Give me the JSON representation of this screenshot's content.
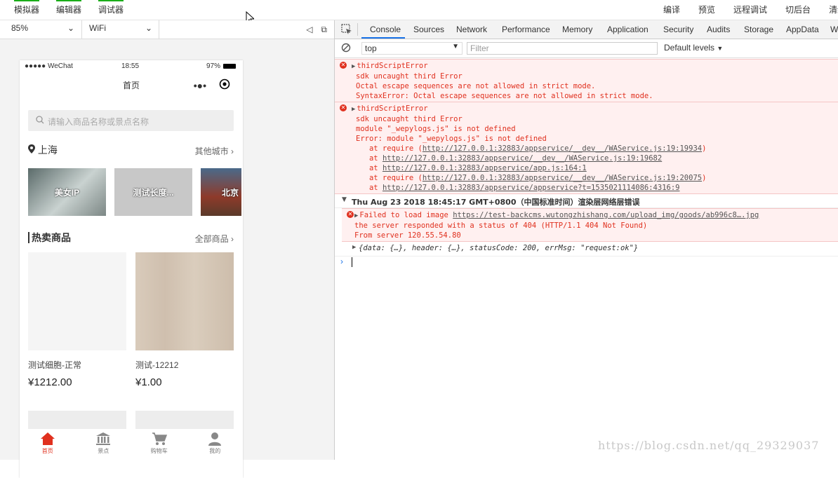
{
  "top_menu": {
    "left": [
      "模拟器",
      "编辑器",
      "调试器"
    ],
    "right": [
      "编译",
      "预览",
      "远程调试",
      "切后台",
      "清缓存"
    ]
  },
  "simbar": {
    "zoom": "85%",
    "network": "WiFi"
  },
  "phone": {
    "status_left": "●●●●● WeChat",
    "time": "18:55",
    "battery": "97%",
    "nav_title": "首页",
    "search_placeholder": "请输入商品名称或景点名称",
    "city": "上海",
    "other_cities": "其他城市",
    "banners": [
      "美女IP",
      "测试长度...",
      "北京"
    ],
    "hot_title": "热卖商品",
    "all_goods": "全部商品",
    "goods": [
      {
        "name": "测试细胞-正常",
        "price": "¥1212.00",
        "color": "#f5f5f5"
      },
      {
        "name": "测试-12212",
        "price": "¥1.00",
        "color": "#d7c9b8"
      }
    ],
    "tabs": [
      {
        "label": "首页",
        "icon": "home-icon",
        "active": true
      },
      {
        "label": "景点",
        "icon": "landmark-icon"
      },
      {
        "label": "购物车",
        "icon": "cart-icon"
      },
      {
        "label": "我的",
        "icon": "user-icon"
      }
    ]
  },
  "devtools": {
    "tabs": [
      "Console",
      "Sources",
      "Network",
      "Performance",
      "Memory",
      "Application",
      "Security",
      "Audits",
      "Storage",
      "AppData",
      "W"
    ],
    "context": "top",
    "filter_placeholder": "Filter",
    "levels": "Default levels",
    "error1": {
      "title": "thirdScriptError",
      "lines": [
        "sdk uncaught third Error",
        "Octal escape sequences are not allowed in strict mode.",
        "SyntaxError: Octal escape sequences are not allowed in strict mode."
      ]
    },
    "error2": {
      "title": "thirdScriptError",
      "lines": [
        "sdk uncaught third Error",
        "module \"_wepylogs.js\" is not defined",
        "Error: module \"_wepylogs.js\" is not defined"
      ],
      "stack": [
        {
          "prefix": "   at require (",
          "url": "http://127.0.0.1:32883/appservice/__dev__/WAService.js:19:19934",
          "suffix": ")"
        },
        {
          "prefix": "   at ",
          "url": "http://127.0.0.1:32883/appservice/__dev__/WAService.js:19:19682",
          "suffix": ""
        },
        {
          "prefix": "   at ",
          "url": "http://127.0.0.1:32883/appservice/app.js:164:1",
          "suffix": ""
        },
        {
          "prefix": "   at require (",
          "url": "http://127.0.0.1:32883/appservice/__dev__/WAService.js:19:20075",
          "suffix": ")"
        },
        {
          "prefix": "   at ",
          "url": "http://127.0.0.1:32883/appservice/appservice?t=1535021114086:4316:9",
          "suffix": ""
        }
      ]
    },
    "group_title": "Thu Aug 23 2018 18:45:17 GMT+0800（中国标准时间）渲染层网络层错误",
    "error3": {
      "prefix": "Failed to load image ",
      "url": "https://test-backcms.wutongzhishang.com/upload_img/goods/ab996c8….jpg",
      "lines": [
        "the server responded with a status of 404 (HTTP/1.1 404 Not Found)",
        "From server 120.55.54.80"
      ]
    },
    "object_line": "{data: {…}, header: {…}, statusCode: 200, errMsg: \"request:ok\"}"
  },
  "watermark": "https://blog.csdn.net/qq_29329037"
}
